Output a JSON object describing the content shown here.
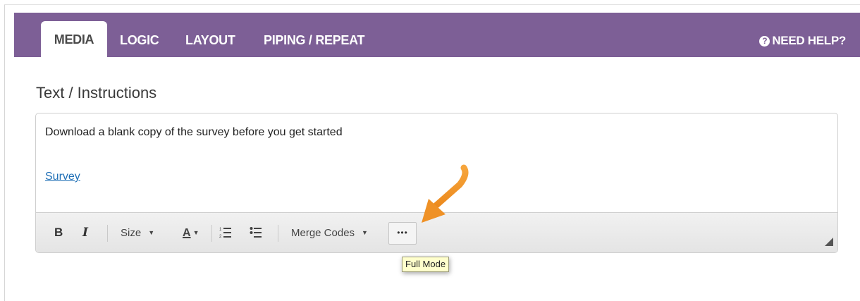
{
  "tabs": [
    {
      "label": "MEDIA",
      "active": true
    },
    {
      "label": "LOGIC"
    },
    {
      "label": "LAYOUT"
    },
    {
      "label": "PIPING / REPEAT"
    }
  ],
  "help": {
    "icon": "question-circle-icon",
    "label": "NEED HELP?"
  },
  "section_title": "Text / Instructions",
  "editor": {
    "text": "Download a blank copy of the survey before you get started",
    "link": "Survey"
  },
  "toolbar": {
    "bold": "B",
    "italic": "I",
    "size_label": "Size",
    "color_label": "A",
    "merge_codes_label": "Merge Codes",
    "more_label": "•••"
  },
  "tooltip": "Full Mode",
  "colors": {
    "brand": "#7d5f96",
    "link": "#1f6fb6",
    "annotation_arrow": "#f0932b"
  }
}
